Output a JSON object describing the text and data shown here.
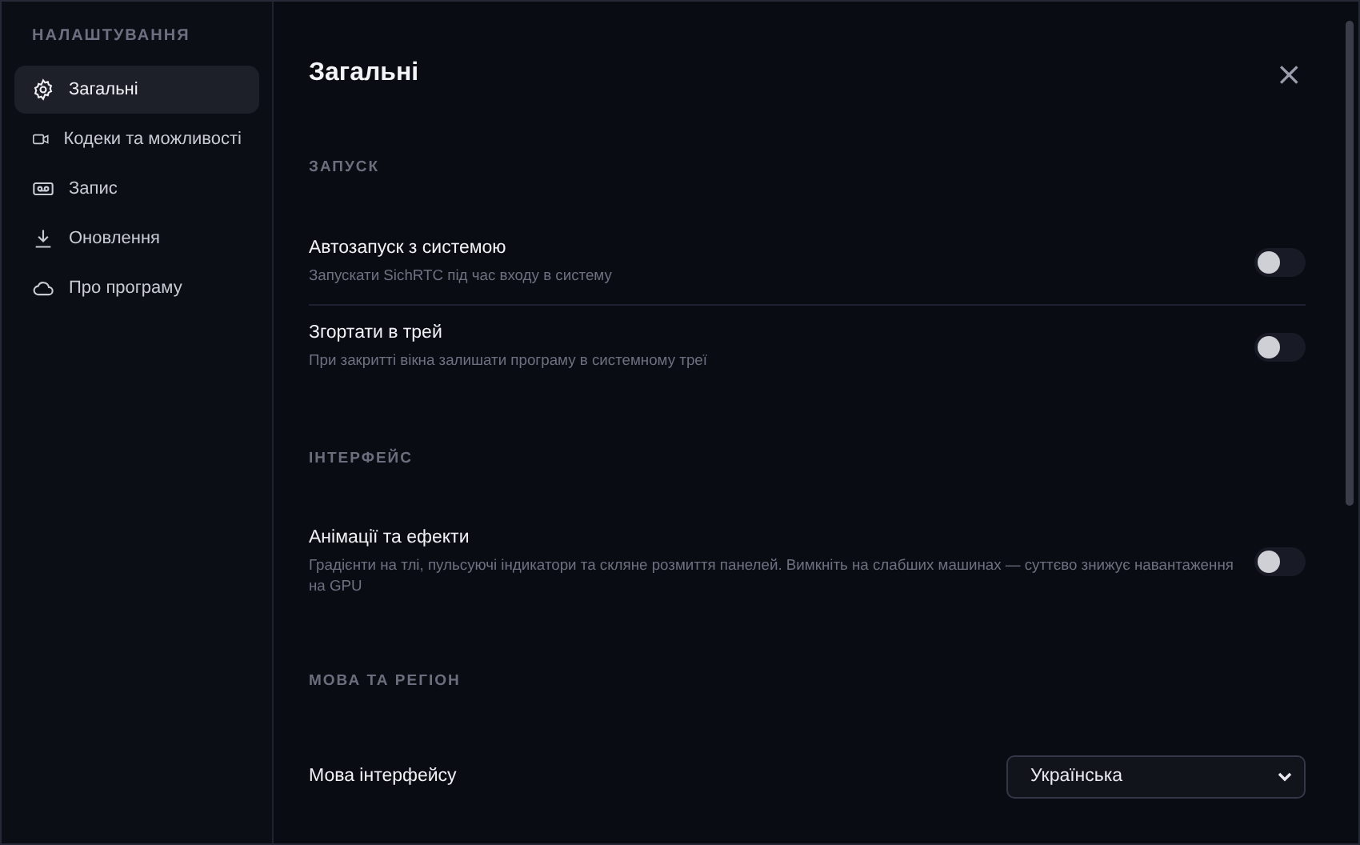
{
  "sidebar": {
    "heading": "НАЛАШТУВАННЯ",
    "items": [
      {
        "label": "Загальні",
        "selected": true
      },
      {
        "label": "Кодеки та можливості",
        "selected": false
      },
      {
        "label": "Запис",
        "selected": false
      },
      {
        "label": "Оновлення",
        "selected": false
      },
      {
        "label": "Про програму",
        "selected": false
      }
    ]
  },
  "panel": {
    "title": "Загальні",
    "close": "×",
    "sections": [
      {
        "heading": "ЗАПУСК",
        "rows": [
          {
            "kind": "toggle",
            "label": "Автозапуск з системою",
            "description": "Запускати SichRTC під час входу в систему",
            "on": false
          },
          {
            "kind": "toggle",
            "label": "Згортати в трей",
            "description": "При закритті вікна залишати програму в системному треї",
            "on": false
          }
        ]
      },
      {
        "heading": "ІНТЕРФЕЙС",
        "rows": [
          {
            "kind": "toggle",
            "label": "Анімації та ефекти",
            "description": "Градієнти на тлі, пульсуючі індикатори та скляне розмиття панелей. Вимкніть на слабших машинах — суттєво знижує навантаження на GPU",
            "on": false
          }
        ]
      },
      {
        "heading": "МОВА ТА РЕГІОН",
        "rows": [
          {
            "kind": "select",
            "label": "Мова інтерфейсу",
            "value": "Українська"
          }
        ]
      }
    ]
  }
}
